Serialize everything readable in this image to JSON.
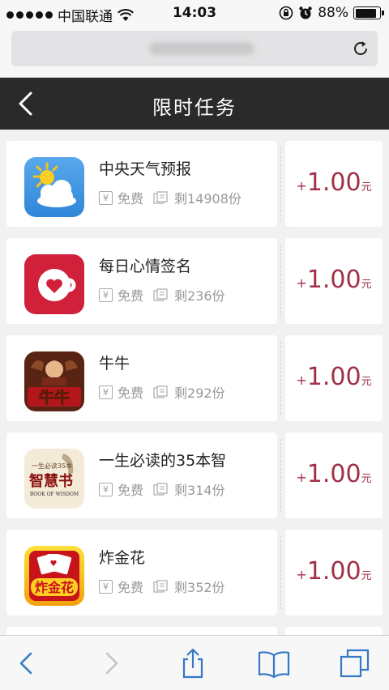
{
  "status_bar": {
    "carrier": "中国联通",
    "time": "14:03",
    "battery": "88%",
    "battery_level": 0.88
  },
  "header": {
    "title": "限时任务"
  },
  "tasks": [
    {
      "name": "中央天气预报",
      "price": "免费",
      "remaining": "剩14908份",
      "reward_plus": "+",
      "reward": "1.00",
      "reward_unit": "元",
      "icon": "weather-icon"
    },
    {
      "name": "每日心情签名",
      "price": "免费",
      "remaining": "剩236份",
      "reward_plus": "+",
      "reward": "1.00",
      "reward_unit": "元",
      "icon": "heart-cup-icon"
    },
    {
      "name": "牛牛",
      "price": "免费",
      "remaining": "剩292份",
      "reward_plus": "+",
      "reward": "1.00",
      "reward_unit": "元",
      "icon": "niuniu-game-icon"
    },
    {
      "name": "一生必读的35本智",
      "price": "免费",
      "remaining": "剩314份",
      "reward_plus": "+",
      "reward": "1.00",
      "reward_unit": "元",
      "icon": "wisdom-book-icon"
    },
    {
      "name": "炸金花",
      "price": "免费",
      "remaining": "剩352份",
      "reward_plus": "+",
      "reward": "1.00",
      "reward_unit": "元",
      "icon": "zhajinhua-game-icon"
    }
  ],
  "app_icon_texts": {
    "niuniu": "牛牛",
    "wisdom_top": "一生必读35本",
    "wisdom_main": "智慧书",
    "wisdom_sub": "BOOK OF WISDOM",
    "zjh": "炸金花"
  },
  "colors": {
    "header_bg": "#2a2a2a",
    "reward": "#a03048",
    "browser_blue": "#3478c6"
  },
  "toolbar": {
    "icons": [
      "back-arrow-icon",
      "forward-arrow-icon",
      "share-icon",
      "bookmarks-icon",
      "tabs-icon"
    ]
  }
}
